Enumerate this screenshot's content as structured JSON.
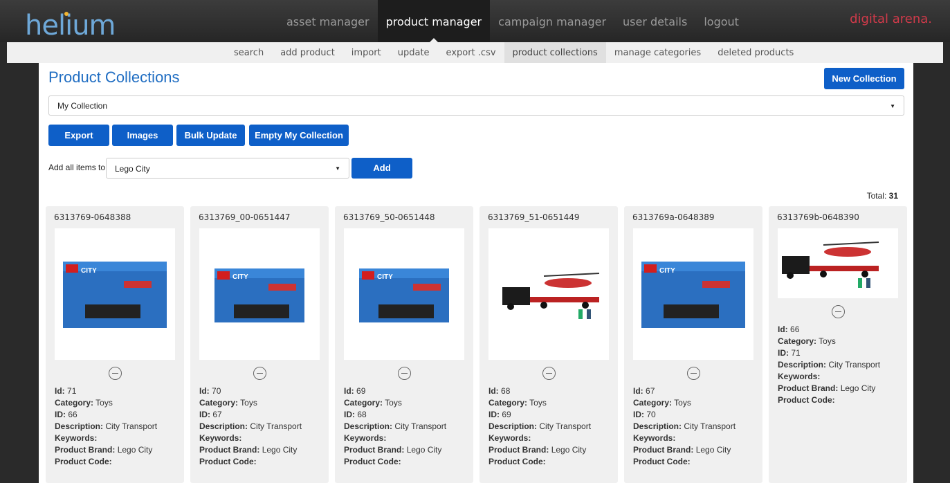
{
  "app": {
    "logo": "helium",
    "brand": "digital arena."
  },
  "topnav": [
    "asset manager",
    "product manager",
    "campaign manager",
    "user details",
    "logout"
  ],
  "subnav": [
    "search",
    "add product",
    "import",
    "update",
    "export .csv",
    "product collections",
    "manage categories",
    "deleted products"
  ],
  "page": {
    "title": "Product Collections",
    "new_collection": "New Collection",
    "collection_value": "My Collection",
    "actions": {
      "export": "Export",
      "images": "Images",
      "bulk_update": "Bulk Update",
      "empty": "Empty My Collection"
    },
    "add_all_label": "Add all items to",
    "add_target": "Lego City",
    "add_button": "Add",
    "total_label": "Total:",
    "total_value": "31"
  },
  "labels": {
    "id": "Id:",
    "category": "Category:",
    "id_upper": "ID:",
    "description": "Description:",
    "keywords": "Keywords:",
    "product_brand": "Product Brand:",
    "product_code": "Product Code:"
  },
  "cards": [
    {
      "code": "6313769-0648388",
      "id": "71",
      "category": "Toys",
      "id_upper": "66",
      "description": "City Transport",
      "brand": "Lego City"
    },
    {
      "code": "6313769_00-0651447",
      "id": "70",
      "category": "Toys",
      "id_upper": "67",
      "description": "City Transport",
      "brand": "Lego City"
    },
    {
      "code": "6313769_50-0651448",
      "id": "69",
      "category": "Toys",
      "id_upper": "68",
      "description": "City Transport",
      "brand": "Lego City"
    },
    {
      "code": "6313769_51-0651449",
      "id": "68",
      "category": "Toys",
      "id_upper": "69",
      "description": "City Transport",
      "brand": "Lego City"
    },
    {
      "code": "6313769a-0648389",
      "id": "67",
      "category": "Toys",
      "id_upper": "70",
      "description": "City Transport",
      "brand": "Lego City"
    },
    {
      "code": "6313769b-0648390",
      "id": "66",
      "category": "Toys",
      "id_upper": "71",
      "description": "City Transport",
      "brand": "Lego City"
    }
  ],
  "box_text": "CITY"
}
